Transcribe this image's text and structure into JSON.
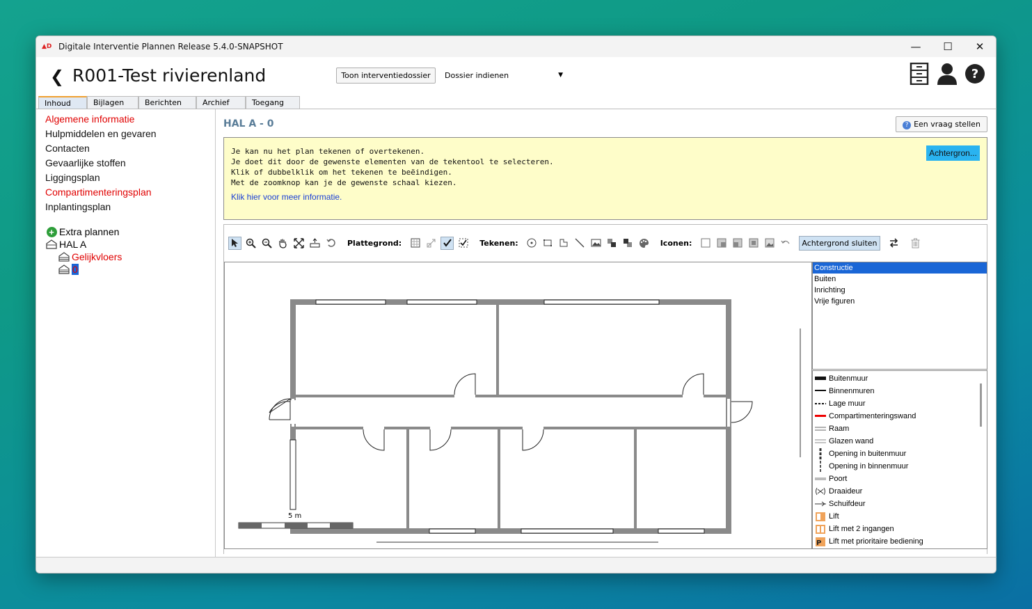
{
  "window": {
    "title": "Digitale Interventie Plannen Release 5.4.0-SNAPSHOT",
    "controls": [
      "minimize-icon",
      "maximize-icon",
      "close-icon"
    ]
  },
  "header": {
    "back_icon": "chevron-left-icon",
    "title": "R001-Test rivierenland",
    "toon_button": "Toon interventiedossier",
    "dossier_select": "Dossier indienen",
    "icons": [
      "cabinet-icon",
      "user-icon",
      "help-icon"
    ]
  },
  "tabs": [
    "Inhoud",
    "Bijlagen",
    "Berichten",
    "Archief",
    "Toegang"
  ],
  "sidebar": {
    "items": [
      {
        "label": "Algemene informatie",
        "red": true
      },
      {
        "label": "Hulpmiddelen en gevaren",
        "red": false
      },
      {
        "label": "Contacten",
        "red": false
      },
      {
        "label": "Gevaarlijke stoffen",
        "red": false
      },
      {
        "label": "Liggingsplan",
        "red": false
      },
      {
        "label": "Compartimenteringsplan",
        "red": true
      },
      {
        "label": "Inplantingsplan",
        "red": false
      }
    ],
    "tree": {
      "extra": "Extra plannen",
      "hal": "HAL A",
      "child1": "Gelijkvloers",
      "child2": "0"
    }
  },
  "main": {
    "title": "HAL A - 0",
    "vraag_button": "Een vraag stellen",
    "info": {
      "lines": [
        "Je kan nu het plan tekenen of overtekenen.",
        "Je doet dit door de gewenste elementen van de tekentool te selecteren.",
        "Klik of dubbelklik om het tekenen te beëindigen.",
        "Met de zoomknop kan je de gewenste schaal kiezen."
      ],
      "link": "Klik hier voor meer informatie.",
      "achtergrond_button": "Achtergron..."
    },
    "toolbar": {
      "plattegrond_label": "Plattegrond:",
      "tekenen_label": "Tekenen:",
      "iconen_label": "Iconen:",
      "sluiten_button": "Achtergrond sluiten"
    },
    "scale_label": "5 m",
    "layers": [
      "Constructie",
      "Buiten",
      "Inrichting",
      "Vrije figuren"
    ],
    "legend": [
      "Buitenmuur",
      "Binnenmuren",
      "Lage muur",
      "Compartimenteringswand",
      "Raam",
      "Glazen wand",
      "Opening in buitenmuur",
      "Opening in binnenmuur",
      "Poort",
      "Draaideur",
      "Schuifdeur",
      "Lift",
      "Lift met 2 ingangen",
      "Lift met prioritaire bediening"
    ],
    "colors": {
      "accent": "#1a66d6",
      "red_text": "#e00000",
      "info_bg": "#fefdc9",
      "wall": "#8a8a8a"
    }
  }
}
